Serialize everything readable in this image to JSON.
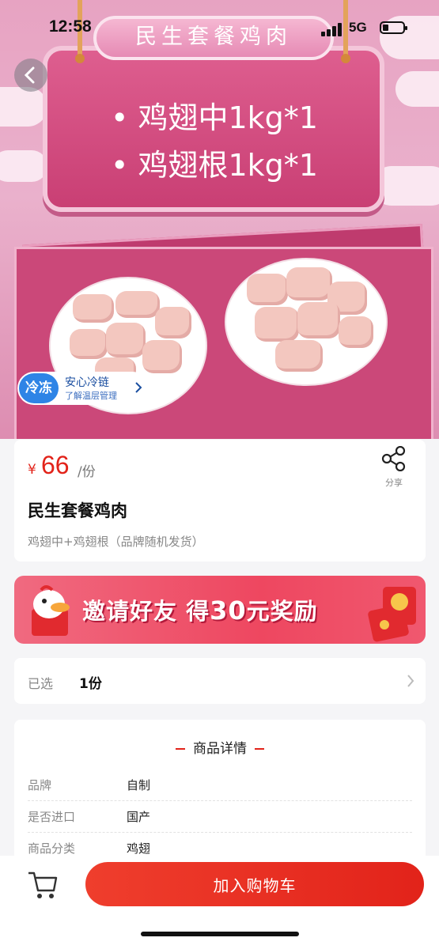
{
  "status_bar": {
    "time": "12:58",
    "network": "5G"
  },
  "hero": {
    "sign_title": "民生套餐鸡肉",
    "bullets": [
      "• 鸡翅中1kg*1",
      "• 鸡翅根1kg*1"
    ],
    "cold_chain": {
      "badge": "冷冻",
      "title": "安心冷链",
      "subtitle": "了解温层管理"
    }
  },
  "product": {
    "currency": "¥",
    "price": "66",
    "unit": "/份",
    "share_label": "分享",
    "title": "民生套餐鸡肉",
    "subtitle": "鸡翅中+鸡翅根（品牌随机发货）"
  },
  "banner": {
    "text_prefix": "邀请好友 得",
    "amount": "30",
    "text_suffix": "元奖励"
  },
  "selection": {
    "label": "已选",
    "value": "1份"
  },
  "details": {
    "heading": "商品详情",
    "rows": [
      {
        "key": "品牌",
        "value": "自制"
      },
      {
        "key": "是否进口",
        "value": "国产"
      },
      {
        "key": "商品分类",
        "value": "鸡翅"
      }
    ]
  },
  "bottom_bar": {
    "add_to_cart": "加入购物车"
  },
  "colors": {
    "accent": "#e2231a",
    "hero_pink": "#de5e8f",
    "cold_blue": "#2e84e6"
  },
  "icons": [
    "back-icon",
    "share-icon",
    "chevron-right-icon",
    "cart-icon",
    "signal-icon",
    "battery-icon"
  ]
}
